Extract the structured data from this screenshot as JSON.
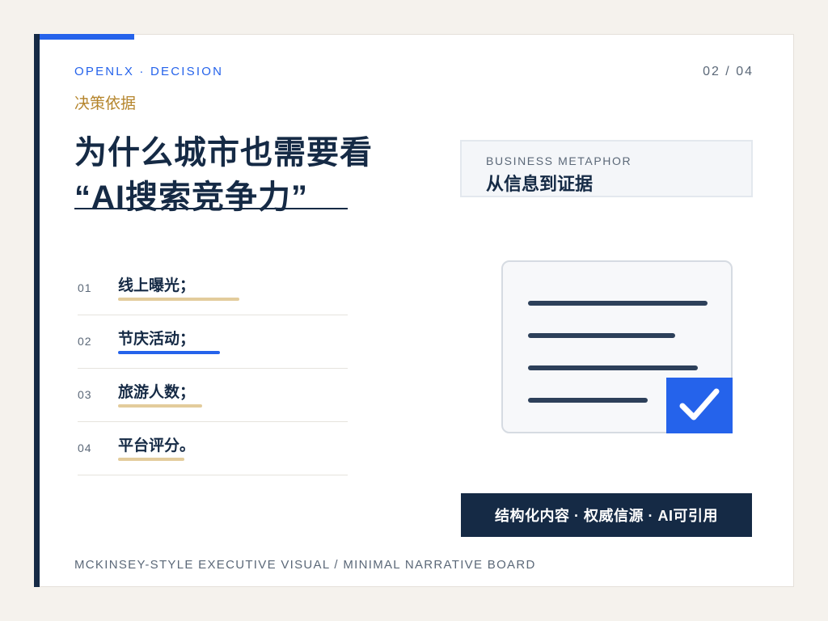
{
  "header": {
    "brand": "OPENLX · DECISION",
    "page_number": "02 / 04",
    "eyebrow": "决策依据"
  },
  "title": {
    "line1": "为什么城市也需要看",
    "line2": "“AI搜索竞争力”"
  },
  "metaphor": {
    "label": "BUSINESS METAPHOR",
    "title": "从信息到证据"
  },
  "list": [
    {
      "num": "01",
      "text": "线上曝光；",
      "underline_color": "#e3cc9c"
    },
    {
      "num": "02",
      "text": "节庆活动；",
      "underline_color": "#2563eb"
    },
    {
      "num": "03",
      "text": "旅游人数；",
      "underline_color": "#e3cc9c"
    },
    {
      "num": "04",
      "text": "平台评分。",
      "underline_color": "#e3cc9c"
    }
  ],
  "tagline": "结构化内容 · 权威信源 · AI可引用",
  "footer": "MCKINSEY-STYLE EXECUTIVE VISUAL / MINIMAL NARRATIVE BOARD",
  "colors": {
    "navy": "#152a45",
    "blue": "#2563eb",
    "gold": "#b5852c",
    "sand": "#e3cc9c"
  },
  "icons": {
    "illustration": "document-icon",
    "check": "check-icon"
  }
}
